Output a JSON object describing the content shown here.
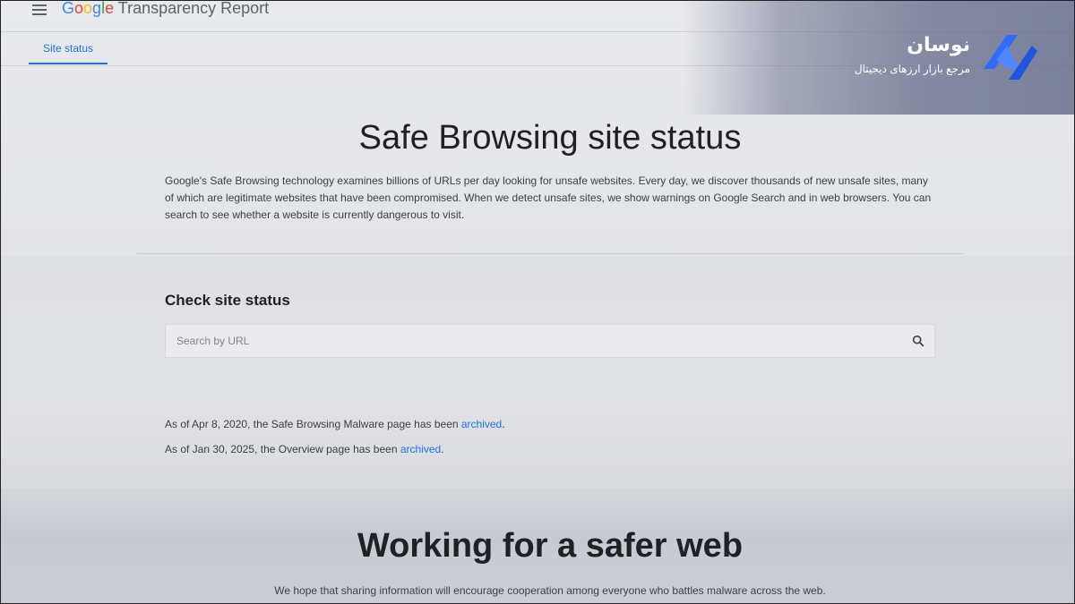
{
  "header": {
    "brand_parts": [
      "G",
      "o",
      "o",
      "g",
      "l",
      "e"
    ],
    "product": "Transparency Report",
    "tab_label": "Site status"
  },
  "watermark": {
    "title": "نوسان",
    "subtitle": "مرجع بازار ارزهای دیجیتال"
  },
  "main": {
    "title": "Safe Browsing site status",
    "intro": "Google's Safe Browsing technology examines billions of URLs per day looking for unsafe websites. Every day, we discover thousands of new unsafe sites, many of which are legitimate websites that have been compromised. When we detect unsafe sites, we show warnings on Google Search and in web browsers. You can search to see whether a website is currently dangerous to visit.",
    "check_title": "Check site status",
    "search_placeholder": "Search by URL",
    "search_value": "",
    "note1_prefix": "As of Apr 8, 2020, the Safe Browsing Malware page has been ",
    "note1_link": "archived",
    "note2_prefix": "As of Jan 30, 2025, the Overview page has been ",
    "note2_link": "archived",
    "note_suffix": "."
  },
  "footer": {
    "title": "Working for a safer web",
    "text": "We hope that sharing information will encourage cooperation among everyone who battles malware across the web."
  },
  "colors": {
    "accent": "#1a73e8",
    "text": "#202124",
    "watermark_bg": "#646a87"
  },
  "icons": [
    "menu-icon",
    "search-icon",
    "nosan-logo-icon"
  ]
}
